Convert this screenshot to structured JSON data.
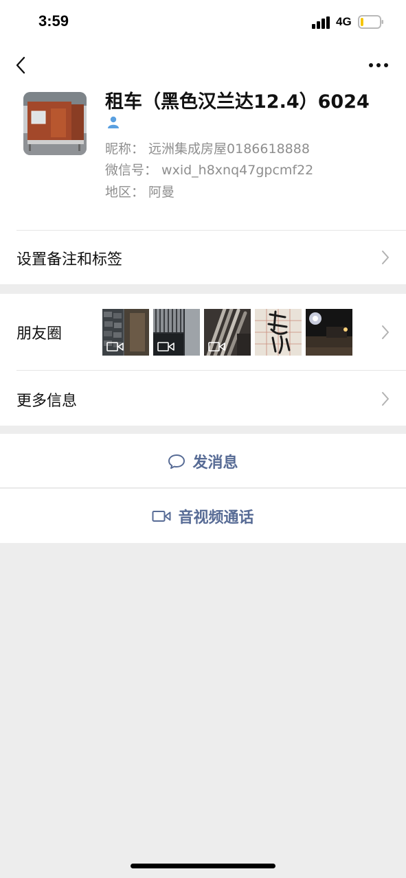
{
  "status_bar": {
    "time": "3:59",
    "network": "4G",
    "battery_level": 0.15,
    "battery_color": "#f5c400"
  },
  "nav": {
    "back_icon": "chevron-left-icon",
    "more_icon": "ellipsis-icon"
  },
  "profile": {
    "name": "租车（黑色汉兰达12.4）6024",
    "badge_icon": "contact-person-icon",
    "nickname_line": "昵称：  远洲集成房屋0186618888",
    "wechat_id_line": "微信号：  wxid_h8xnq47gpcmf22",
    "region_line": "地区：  阿曼"
  },
  "rows": {
    "remark_label": "设置备注和标签",
    "moments_label": "朋友圈",
    "more_info_label": "更多信息"
  },
  "moments_thumbnails": [
    {
      "name": "stone-wall",
      "has_video": true
    },
    {
      "name": "metal-grate",
      "has_video": true
    },
    {
      "name": "pipes",
      "has_video": true
    },
    {
      "name": "calligraphy",
      "has_video": false
    },
    {
      "name": "night-yard",
      "has_video": false
    }
  ],
  "actions": {
    "message_label": "发消息",
    "message_icon": "chat-bubble-icon",
    "video_call_label": "音视频通话",
    "video_call_icon": "video-camera-icon"
  },
  "colors": {
    "accent_link": "#576b95",
    "background": "#ededed",
    "card": "#ffffff"
  }
}
